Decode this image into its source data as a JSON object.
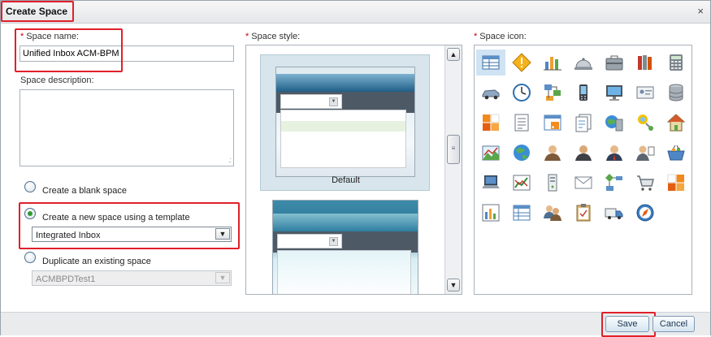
{
  "dialog": {
    "title": "Create Space",
    "close_symbol": "×"
  },
  "form": {
    "space_name_label": "Space name:",
    "space_name_value": "Unified Inbox ACM-BPM",
    "space_description_label": "Space description:",
    "options": [
      {
        "label": "Create a blank space",
        "selected": false
      },
      {
        "label": "Create a new space using a template",
        "selected": true
      },
      {
        "label": "Duplicate an existing space",
        "selected": false
      }
    ],
    "template_select_value": "Integrated Inbox",
    "duplicate_select_value": "ACMBPDTest1",
    "required_marker": "*"
  },
  "style_panel": {
    "label": "Space style:",
    "styles": [
      {
        "name": "Default",
        "selected": true
      },
      {
        "name": "",
        "selected": false
      }
    ]
  },
  "icon_panel": {
    "label": "Space icon:",
    "icons": [
      "table-icon",
      "warning-diamond-icon",
      "bar-chart-icon",
      "service-bell-icon",
      "briefcase-icon",
      "books-icon",
      "calculator-icon",
      "car-icon",
      "clock-icon",
      "workflow-icon",
      "mobile-device-icon",
      "computer-monitor-icon",
      "id-card-icon",
      "database-icon",
      "pie-quarters-icon",
      "document-list-icon",
      "rss-window-icon",
      "document-pages-icon",
      "globe-server-icon",
      "network-person-icon",
      "home-icon",
      "landscape-chart-icon",
      "globe-icon",
      "person-icon",
      "person-dark-icon",
      "person-tie-icon",
      "person-list-icon",
      "shopping-basket-icon",
      "laptop-icon",
      "trend-chart-icon",
      "server-tower-icon",
      "envelope-icon",
      "flowchart-icon",
      "shopping-cart-icon",
      "puzzle-pie-icon",
      "column-chart-icon",
      "spreadsheet-icon",
      "group-icon",
      "clipboard-icon",
      "delivery-truck-icon",
      "compass-icon"
    ],
    "selected_index": 0
  },
  "buttons": {
    "save": "Save",
    "cancel": "Cancel"
  },
  "colors": {
    "highlight_red": "#e0202a",
    "radio_selected": "#2f9b2f",
    "selected_icon_bg": "#cfe3f3"
  }
}
